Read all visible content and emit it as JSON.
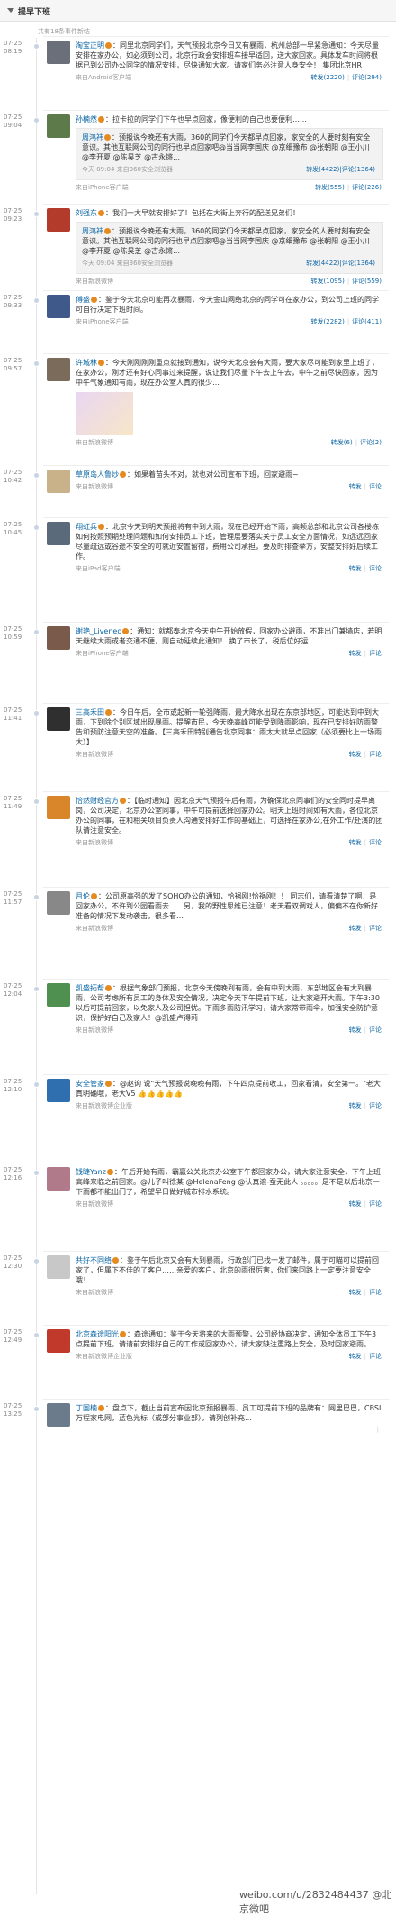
{
  "header": {
    "title": "提早下班",
    "total": "共有18条事件新结"
  },
  "posts": [
    {
      "date": "07-25",
      "time": "08:19",
      "name": "淘宝正明",
      "text": "：同里北京同学们，天气预报北京今日又有暴雨，杭州总部一早紧急通知：今天尽量安排在家办公，如必须到公司，北京行政会安排班车接早适回，送大家回家。具体发车时间将根据已到公司办公同学的情况安排，尽快通知大家。请家们务必注意人身安全！ 集团北京HR",
      "source": "来自Android客户端",
      "likes": "",
      "fwd": "转发(2220)",
      "cmt": "评论(294)"
    },
    {
      "date": "07-25",
      "time": "09:04",
      "name": "孙楠然",
      "text": "：拉卡拉的同学们下午也早点回家，像便利的自己也要便利……",
      "quote": {
        "name": "周鸿祎",
        "text": "：预报说今晚还有大雨，360的同学们今天都早点回家，家安全的人要时刻有安全意识。其他互联网公司的同行也早点回家吧@当当网李国庆 @京细豫布 @张朝阳 @王小川 @李开夏 @陈昊芝 @古永锵…",
        "time": "今天 09:04",
        "src": "来自360安全浏览器",
        "fwd": "转发(4422)",
        "cmt": "评论(1364)"
      },
      "source": "来自iPhone客户端",
      "fwd": "转发(555)",
      "cmt": "评论(226)"
    },
    {
      "date": "07-25",
      "time": "09:23",
      "name": "刘强东",
      "text": "：我们一大早就安排好了！包括在大街上奔行的配送兄弟们！",
      "quote": {
        "name": "周鸿祎",
        "text": "：预报说今晚还有大雨，360的同学们今天都早点回家，家安全的人要时刻有安全意识。其他互联网公司的同行也早点回家吧@当当网李国庆 @京细豫布 @张朝阳 @王小川 @李开夏 @陈昊芝 @古永锵…",
        "time": "今天 09:04",
        "src": "来自360安全浏览器",
        "fwd": "转发(4422)",
        "cmt": "评论(1364)"
      },
      "source": "来自新浪微博",
      "fwd": "转发(1095)",
      "cmt": "评论(559)"
    },
    {
      "date": "07-25",
      "time": "09:33",
      "name": "傅盛",
      "text": "：鉴于今天北京可能再次暴雨，今天金山网络北京的同学可在家办公，到公司上班的同学可自行决定下班时间。",
      "source": "来自iPhone客户端",
      "fwd": "转发(2282)",
      "cmt": "评论(411)"
    },
    {
      "date": "07-25",
      "time": "09:57",
      "name": "许城林",
      "text": "：今天刚刚刚刚重点就接到通知，说今天北京会有大雨，要大家尽可能到家里上班了，在家办公，刚才还有好心同事过来提醒，说让我们尽量下午去上午去，中午之前尽快回家，因为中午气象通知有雨，现在办公室人真的很少…",
      "thumb": true,
      "source": "来自新浪微博",
      "fwd": "转发(6)",
      "cmt": "评论(2)"
    },
    {
      "date": "07-25",
      "time": "10:42",
      "name": "草原岛人鲁炒",
      "text": "：如果着苗头不对，就也对公司宣布下班，回家避雨~",
      "source": "来自新浪微博",
      "fwd": "转发",
      "cmt": "评论"
    },
    {
      "date": "07-25",
      "time": "10:45",
      "name": "翔虹兵",
      "text": "：北京今天到明天预报将有中到大雨，现在已经开始下雨，高频总部和北京公司各楼栋如何按照预期处理问题和如何安排员工下班，管理层要落实关于员工安全方面情况，如远远回家尽量疏远或谷途不安全的可就近安置留宿，费用公司承担，要及时排查举方，安整安排好后续工作。",
      "source": "来自iPad客户端",
      "fwd": "转发",
      "cmt": "评论"
    },
    {
      "date": "07-25",
      "time": "10:59",
      "name": "谢艳_Liveneo",
      "text": "：通知：就都泰北京今天中午开始放假，回家办公避雨，不准出门兼墙店，若明天继续大雨或者交通不便，则自动延续此通知！ 换了市长了，税后位好运！",
      "source": "来自iPhone客户端",
      "fwd": "转发",
      "cmt": "评论"
    },
    {
      "date": "07-25",
      "time": "11:41",
      "name": "三高禾田",
      "text": "：今日午后，全市或起新一轮强降雨，最大降水出现在东京部地区，可能达到中到大雨，下到除个别区域出现暴雨。提醒市民，今天晚高峰可能受到降雨影响，现在已安排好防雨警告和预防注意天空的准备。【三高禾田特别通告北京同事：雨太大就早点回家（必须要比上一场雨大）】",
      "source": "来自新浪微博",
      "fwd": "转发",
      "cmt": "评论"
    },
    {
      "date": "07-25",
      "time": "11:49",
      "name": "恰然财经官方",
      "text": "：【临时通知】因北京天气预报午后有雨，为确保北京同事们的安全同时提早离岗，公司决定，北京办公室同事，中午可提前选择回家办公。明天上班时间如有大雨，各位北京办公的同事，在和相关项目负责人沟通安排好工作的基础上，可选择在家办公,在外工作/赴演的团队请注意安全。",
      "source": "来自新浪微博",
      "fwd": "转发",
      "cmt": "评论"
    },
    {
      "date": "07-25",
      "time": "11:57",
      "name": "月伦",
      "text": "：公司原高强的发了SOHO办公的通知，恰祸刚!恰祸刚！！ 同志们，请看清楚了啊，是回家办公，不许到公园看雨去……另，我的野性思维已注意！老天看双调戏人，偏偏不在你新好准备的情况下发动袭击，很多看…",
      "emo": true,
      "source": "来自新浪微博",
      "fwd": "转发",
      "cmt": "评论"
    },
    {
      "date": "07-25",
      "time": "12:04",
      "name": "凯盛拓帮",
      "text": "：根据气象部门预报，北京今天傍晚到有雨，会有中到大雨，东部地区会有大到暴雨，公司考虑所有员工的身体及安全情况，决定今天下午提前下班，让大家避开大雨。下午3:30以后可提前回家，以免家人及公司担忧。下雨多雨防汛学习，请大家常带雨伞，加强安全防护意识，保护好自己及家人！@凯盛卢得莉",
      "source": "来自新浪微博",
      "fwd": "转发",
      "cmt": "评论"
    },
    {
      "date": "07-25",
      "time": "12:10",
      "name": "安全管家",
      "text": "：@赵询 说\"天气预报说晚晚有雨，下午四点提前收工，回家看清，安全第一。\"老大真明确哦，老大V5 👍👍👍👍👍",
      "emo": true,
      "source": "来自新浪微博企业版",
      "fwd": "转发",
      "cmt": "评论"
    },
    {
      "date": "07-25",
      "time": "12:16",
      "name": "钱睫Yanz",
      "text": "：午后开始有雨，霸赢公关北京办公室下午都回家办公，请大家注意安全，下午上班高峰来临之前回家。@儿子叫徐某 @HelenaFeng @认真滚-蚕无此人 。。。。。是不是以后北京一下雨都不能出门了，希望早日做好城市排水系统。",
      "source": "来自新浪微博",
      "fwd": "转发",
      "cmt": "评论"
    },
    {
      "date": "07-25",
      "time": "12:30",
      "name": "共好不同络",
      "text": "：鉴于午后北京又会有大到暴雨，行政部门已找一发了邮件，属于可瞄可以提前回家了，但属下不佳的了客户……亲爱的客户，北京的雨很厉害，你们来回路上一定要注意安全哦！",
      "source": "来自新浪微博",
      "fwd": "转发",
      "cmt": "评论"
    },
    {
      "date": "07-25",
      "time": "12:49",
      "name": "北京森途阳光",
      "text": "：森途通知：鉴于今天将来的大雨预警，公司经协商决定，通知全体员工下午3点提前下班，请请前安排好自己的工作或回家办公，请大家缺注重路上安全，及时回家避雨。",
      "source": "来自新浪微博企业版",
      "fwd": "转发",
      "cmt": "评论"
    },
    {
      "date": "07-25",
      "time": "13:25",
      "name": "丁国楠",
      "text": "：盘点下，截止当前宣布因北京预报暴雨、员工可提前下班的品牌有：网里巴巴，CBSI万程家电网，蓝色光标（或部分事业部），请列创补充…",
      "source": "",
      "fwd": "",
      "cmt": ""
    }
  ],
  "watermark": "weibo.com/u/2832484437",
  "watermark_user": "@北京微吧"
}
